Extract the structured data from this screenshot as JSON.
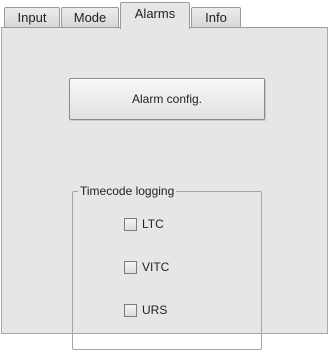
{
  "tabs": [
    {
      "label": "Input",
      "active": false
    },
    {
      "label": "Mode",
      "active": false
    },
    {
      "label": "Alarms",
      "active": true
    },
    {
      "label": "Info",
      "active": false
    }
  ],
  "alarm_config_button": "Alarm config.",
  "timecode_logging": {
    "title": "Timecode logging",
    "options": [
      {
        "label": "LTC",
        "checked": false
      },
      {
        "label": "VITC",
        "checked": false
      },
      {
        "label": "URS",
        "checked": false
      }
    ]
  }
}
